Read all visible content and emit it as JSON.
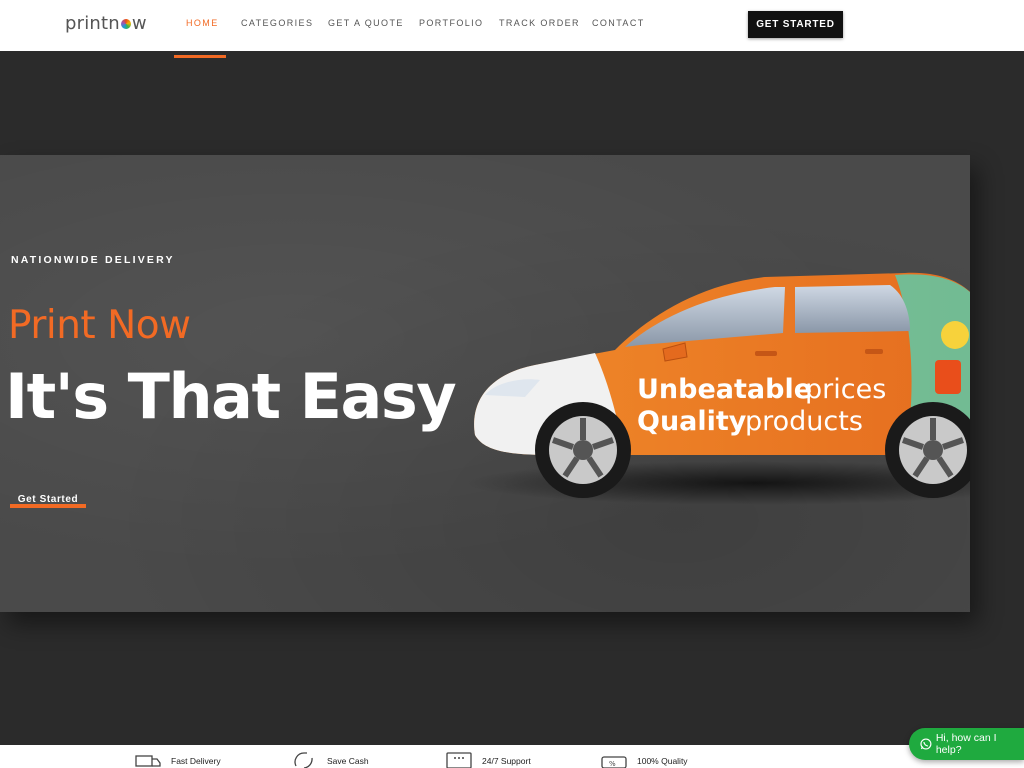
{
  "brand": {
    "logo_pre": "printn",
    "logo_post": "w"
  },
  "nav": {
    "items": [
      {
        "label": "HOME",
        "active": true
      },
      {
        "label": "CATEGORIES",
        "active": false
      },
      {
        "label": "GET A QUOTE",
        "active": false
      },
      {
        "label": "PORTFOLIO",
        "active": false
      },
      {
        "label": "TRACK ORDER",
        "active": false
      },
      {
        "label": "CONTACT",
        "active": false
      }
    ],
    "cta": "GET STARTED"
  },
  "hero": {
    "eyebrow": "NATIONWIDE DELIVERY",
    "subtitle": "Print Now",
    "title": "It's That Easy",
    "cta": "Get Started",
    "car_text_line1_bold": "Unbeatable",
    "car_text_line1_light": "prices",
    "car_text_line2_bold": "Quality",
    "car_text_line2_light": "products"
  },
  "features": [
    {
      "label": "Fast Delivery",
      "icon": "truck-icon"
    },
    {
      "label": "Save Cash",
      "icon": "refresh-cash-icon"
    },
    {
      "label": "24/7 Support",
      "icon": "chat-support-icon"
    },
    {
      "label": "100% Quality",
      "icon": "quality-badge-icon"
    }
  ],
  "chat": {
    "label": "Hi, how can I help?",
    "icon": "whatsapp-icon"
  },
  "colors": {
    "accent": "#f26a24",
    "hero_bg": "#4a4a4a",
    "page_bg": "#2b2b2b",
    "chat_green": "#1faa3f"
  }
}
